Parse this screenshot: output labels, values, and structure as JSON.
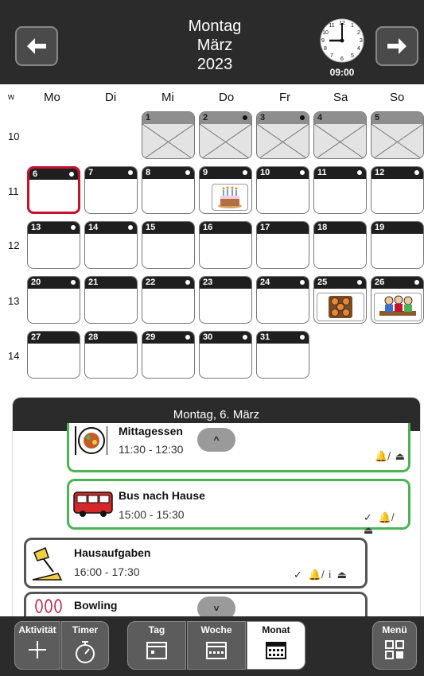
{
  "header": {
    "title_lines": [
      "Montag",
      "März",
      "2023"
    ],
    "clock_time": "09:00",
    "prev_icon": "arrow-left-icon",
    "next_icon": "arrow-right-icon"
  },
  "calendar": {
    "week_header": "w",
    "weekdays": [
      "Mo",
      "Di",
      "Mi",
      "Do",
      "Fr",
      "Sa",
      "So"
    ],
    "weeks": [
      "10",
      "11",
      "12",
      "13",
      "14"
    ],
    "days": [
      {
        "n": "1",
        "s": "past"
      },
      {
        "n": "2",
        "s": "past",
        "dot": true
      },
      {
        "n": "3",
        "s": "past",
        "dot": true
      },
      {
        "n": "4",
        "s": "past"
      },
      {
        "n": "5",
        "s": "past"
      },
      {
        "n": "6",
        "s": "today",
        "dot": true
      },
      {
        "n": "7",
        "dot": true
      },
      {
        "n": "8",
        "dot": true
      },
      {
        "n": "9",
        "dot": true,
        "pic": "birthday-cake-icon"
      },
      {
        "n": "10",
        "dot": true
      },
      {
        "n": "11",
        "dot": true
      },
      {
        "n": "12",
        "dot": true
      },
      {
        "n": "13",
        "dot": true
      },
      {
        "n": "14",
        "dot": true
      },
      {
        "n": "15"
      },
      {
        "n": "16"
      },
      {
        "n": "17"
      },
      {
        "n": "18"
      },
      {
        "n": "19"
      },
      {
        "n": "20",
        "dot": true
      },
      {
        "n": "21"
      },
      {
        "n": "22",
        "dot": true
      },
      {
        "n": "23"
      },
      {
        "n": "24",
        "dot": true
      },
      {
        "n": "25",
        "dot": true,
        "pic": "baking-buns-icon"
      },
      {
        "n": "26",
        "dot": true,
        "pic": "people-meeting-icon"
      },
      {
        "n": "27"
      },
      {
        "n": "28"
      },
      {
        "n": "29",
        "dot": true
      },
      {
        "n": "30",
        "dot": true
      },
      {
        "n": "31",
        "dot": true
      }
    ]
  },
  "detail": {
    "heading": "Montag, 6. März",
    "events": [
      {
        "title": "Mittagessen",
        "time": "11:30 - 12:30",
        "icons": "🔔̸ ⏏",
        "style": "green"
      },
      {
        "title": "Bus nach Hause",
        "time": "15:00 - 15:30",
        "icons": "✓ 🔔̸ ⏏",
        "style": "green"
      },
      {
        "title": "Hausaufgaben",
        "time": "16:00 - 17:30",
        "icons": "✓ 🔔̸ i ⏏",
        "style": "grey"
      },
      {
        "title": "Bowling",
        "time": "",
        "icons": "",
        "style": "grey"
      }
    ],
    "scroll_up_icon": "chevron-up-icon",
    "scroll_down_icon": "chevron-down-icon"
  },
  "bottombar": {
    "activity": "Aktivität",
    "timer": "Timer",
    "views": [
      "Tag",
      "Woche",
      "Monat"
    ],
    "active_view": "Monat",
    "menu": "Menü"
  },
  "colors": {
    "header": "#2b2b2b",
    "today_border": "#c4122f",
    "event_green": "#4cb454"
  }
}
